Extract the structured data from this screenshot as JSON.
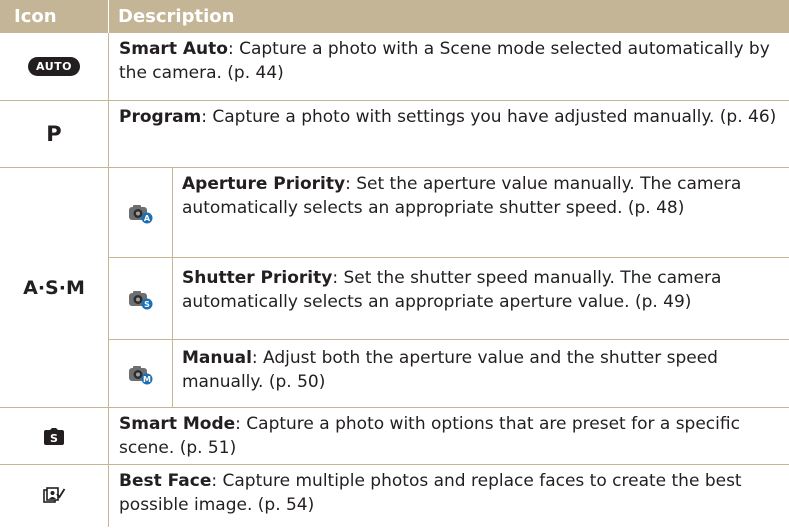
{
  "header": {
    "icon_label": "Icon",
    "description_label": "Description"
  },
  "rows": [
    {
      "icon": "AUTO",
      "title": "Smart Auto",
      "text": ": Capture a photo with a Scene mode selected automatically by the camera. (p. 44)"
    },
    {
      "icon": "P",
      "title": "Program",
      "text": ": Capture a photo with settings you have adjusted manually. (p. 46)"
    },
    {
      "icon": "A·S·M",
      "sub": [
        {
          "title": "Aperture Priority",
          "text": ": Set the aperture value manually. The camera automatically selects an appropriate shutter speed. (p. 48)",
          "icon_letter": "A"
        },
        {
          "title": "Shutter Priority",
          "text": ": Set the shutter speed manually. The camera automatically selects an appropriate aperture value. (p. 49)",
          "icon_letter": "S"
        },
        {
          "title": "Manual",
          "text": ": Adjust both the aperture value and the shutter speed manually. (p. 50)",
          "icon_letter": "M"
        }
      ]
    },
    {
      "icon_name": "smart-mode-icon",
      "title": "Smart Mode",
      "text": ": Capture a photo with options that are preset for a specific scene. (p. 51)"
    },
    {
      "icon_name": "best-face-icon",
      "title": "Best Face",
      "text": ": Capture multiple photos and replace faces to create the best possible image. (p. 54)"
    }
  ],
  "colors": {
    "header_bg": "#c3b596",
    "text": "#231f20",
    "camera_blue": "#1c6fb3"
  }
}
